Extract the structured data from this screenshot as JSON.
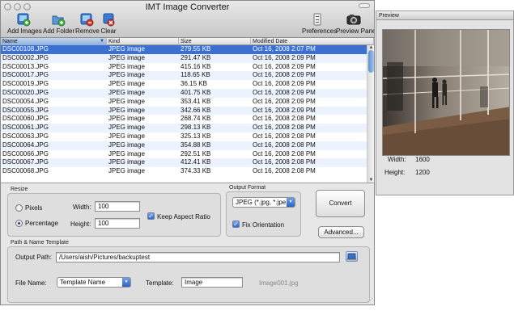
{
  "window": {
    "title": "IMT Image Converter"
  },
  "toolbar": {
    "add_images": "Add Images",
    "add_folder": "Add Folder",
    "remove": "Remove",
    "clear": "Clear",
    "preferences": "Preferences",
    "preview_panel": "Preview Panel"
  },
  "table": {
    "columns": [
      "Name",
      "Kind",
      "Size",
      "Modified Date"
    ],
    "rows": [
      {
        "name": "DSC00108.JPG",
        "kind": "JPEG image",
        "size": "279.55 KB",
        "date": "Oct 16, 2008 2:07 PM"
      },
      {
        "name": "DSC00002.JPG",
        "kind": "JPEG image",
        "size": "291.47 KB",
        "date": "Oct 16, 2008 2:09 PM"
      },
      {
        "name": "DSC00013.JPG",
        "kind": "JPEG image",
        "size": "415.16 KB",
        "date": "Oct 16, 2008 2:09 PM"
      },
      {
        "name": "DSC00017.JPG",
        "kind": "JPEG image",
        "size": "118.65 KB",
        "date": "Oct 16, 2008 2:09 PM"
      },
      {
        "name": "DSC00019.JPG",
        "kind": "JPEG image",
        "size": "36.15 KB",
        "date": "Oct 16, 2008 2:09 PM"
      },
      {
        "name": "DSC00020.JPG",
        "kind": "JPEG image",
        "size": "401.75 KB",
        "date": "Oct 16, 2008 2:09 PM"
      },
      {
        "name": "DSC00054.JPG",
        "kind": "JPEG image",
        "size": "353.41 KB",
        "date": "Oct 16, 2008 2:09 PM"
      },
      {
        "name": "DSC00055.JPG",
        "kind": "JPEG image",
        "size": "342.66 KB",
        "date": "Oct 16, 2008 2:09 PM"
      },
      {
        "name": "DSC00060.JPG",
        "kind": "JPEG image",
        "size": "268.74 KB",
        "date": "Oct 16, 2008 2:08 PM"
      },
      {
        "name": "DSC00061.JPG",
        "kind": "JPEG image",
        "size": "298.13 KB",
        "date": "Oct 16, 2008 2:08 PM"
      },
      {
        "name": "DSC00063.JPG",
        "kind": "JPEG image",
        "size": "325.13 KB",
        "date": "Oct 16, 2008 2:08 PM"
      },
      {
        "name": "DSC00064.JPG",
        "kind": "JPEG image",
        "size": "354.88 KB",
        "date": "Oct 16, 2008 2:08 PM"
      },
      {
        "name": "DSC00066.JPG",
        "kind": "JPEG image",
        "size": "292.51 KB",
        "date": "Oct 16, 2008 2:08 PM"
      },
      {
        "name": "DSC00067.JPG",
        "kind": "JPEG image",
        "size": "412.41 KB",
        "date": "Oct 16, 2008 2:08 PM"
      },
      {
        "name": "DSC00068.JPG",
        "kind": "JPEG image",
        "size": "374.33 KB",
        "date": "Oct 16, 2008 2:08 PM"
      }
    ]
  },
  "resize": {
    "group_label": "Resize",
    "pixels_label": "Pixels",
    "percentage_label": "Percentage",
    "width_label": "Width:",
    "width_value": "100",
    "height_label": "Height:",
    "height_value": "100",
    "keep_aspect_label": "Keep Aspect Ratio",
    "selected": "Percentage"
  },
  "output_format": {
    "group_label": "Output Format",
    "selected": "JPEG (*.jpg, *.jpe",
    "fix_orientation_label": "Fix Orientation"
  },
  "actions": {
    "convert": "Convert",
    "advanced": "Advanced..."
  },
  "path_template": {
    "group_label": "Path & Name Template",
    "output_path_label": "Output Path:",
    "output_path_value": "/Users/aish/Pictures/backuptest",
    "file_name_label": "File Name:",
    "file_name_selected": "Template Name",
    "template_label": "Template:",
    "template_value": "Image",
    "example": "Image001.jpg"
  },
  "preview": {
    "title": "Preview",
    "width_label": "Width:",
    "width_value": "1600",
    "height_label": "Height:",
    "height_value": "1200"
  },
  "colors": {
    "selection": "#3b6fd0",
    "alt_row": "#edf3fe",
    "accent": "#2b63c4"
  }
}
